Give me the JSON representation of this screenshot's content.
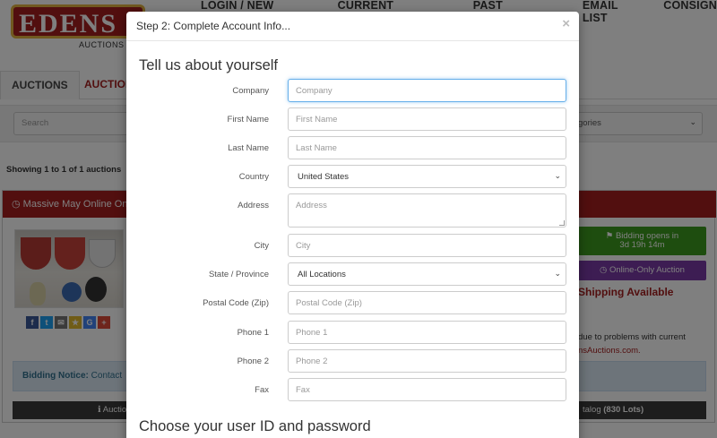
{
  "logo": {
    "text": "EDENS",
    "sub": "AUCTIONS"
  },
  "topnav": [
    "LOGIN / NEW BIDDER",
    "CURRENT AUCTIONS",
    "PAST AUCTIONS",
    "EMAIL LIST",
    "CONSIGN"
  ],
  "tabs": [
    "AUCTIONS",
    "AUCTION"
  ],
  "filter": {
    "search_placeholder": "Search",
    "categories_value": "gories"
  },
  "listing": {
    "showing": "Showing 1 to 1 of 1 auctions",
    "title": "Massive May Online On",
    "bidding_opens_label": "Bidding opens in",
    "bidding_opens_time": "3d 19h 14m",
    "online_only": "Online-Only Auction",
    "shipping": "Shipping Available",
    "note_line1": "due to problems with current",
    "note_line2": "nsAuctions.com.",
    "notice_bold": "Bidding Notice:",
    "notice_text": "Contact",
    "btn_info": "Auctio",
    "btn_catalog": "talog",
    "btn_catalog_count": "(830 Lots)"
  },
  "colors": {
    "brand_red": "#a51e1e",
    "green": "#3d9a1e",
    "purple": "#7a3aa6",
    "focus_blue": "#66afe9"
  },
  "modal": {
    "title": "Step 2: Complete Account Info...",
    "close": "×",
    "section1": "Tell us about yourself",
    "section2": "Choose your user ID and password",
    "fields": {
      "company": {
        "label": "Company",
        "placeholder": "Company"
      },
      "first": {
        "label": "First Name",
        "placeholder": "First Name"
      },
      "last": {
        "label": "Last Name",
        "placeholder": "Last Name"
      },
      "country": {
        "label": "Country",
        "value": "United States"
      },
      "address": {
        "label": "Address",
        "placeholder": "Address"
      },
      "city": {
        "label": "City",
        "placeholder": "City"
      },
      "state": {
        "label": "State / Province",
        "value": "All Locations"
      },
      "postal": {
        "label": "Postal Code (Zip)",
        "placeholder": "Postal Code (Zip)"
      },
      "phone1": {
        "label": "Phone 1",
        "placeholder": "Phone 1"
      },
      "phone2": {
        "label": "Phone 2",
        "placeholder": "Phone 2"
      },
      "fax": {
        "label": "Fax",
        "placeholder": "Fax"
      }
    }
  }
}
